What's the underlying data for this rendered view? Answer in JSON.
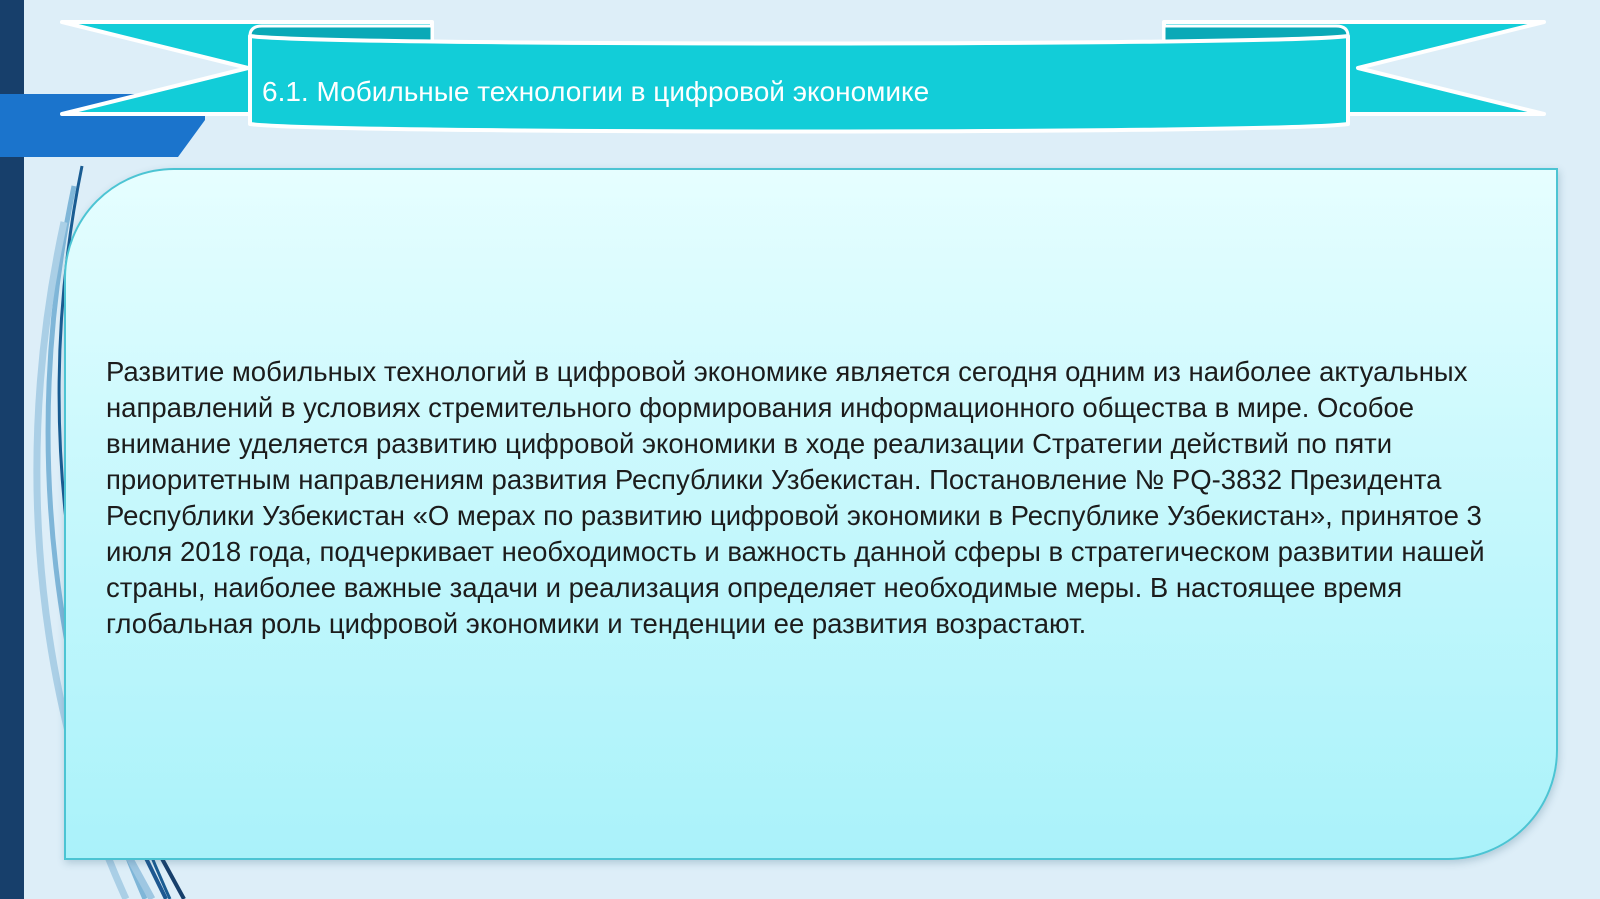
{
  "slide": {
    "title": "6.1. Мобильные технологии в цифровой экономике",
    "body": "Развитие мобильных технологий в цифровой экономике является сегодня одним из наиболее актуальных направлений в условиях стремительного формирования информационного общества в мире. Особое внимание уделяется развитию цифровой экономики в ходе реализации Стратегии действий по пяти приоритетным направлениям развития Республики Узбекистан. Постановление № PQ-3832 Президента Республики Узбекистан «О мерах по развитию цифровой экономики в Республике Узбекистан», принятое 3 июля 2018 года, подчеркивает необходимость и важность данной сферы в стратегическом развитии нашей страны, наиболее важные задачи и реализация определяет необходимые меры. В настоящее время глобальная роль цифровой экономики и тенденции ее развития возрастают."
  },
  "colors": {
    "background": "#ddeef8",
    "left_bar": "#173f6b",
    "accent_blue": "#1b74cc",
    "banner_fill": "#12cdd8",
    "banner_fold": "#0aa9b7",
    "panel_border": "#4cc4d3",
    "body_text": "#1c1c1c",
    "title_text": "#ffffff"
  }
}
